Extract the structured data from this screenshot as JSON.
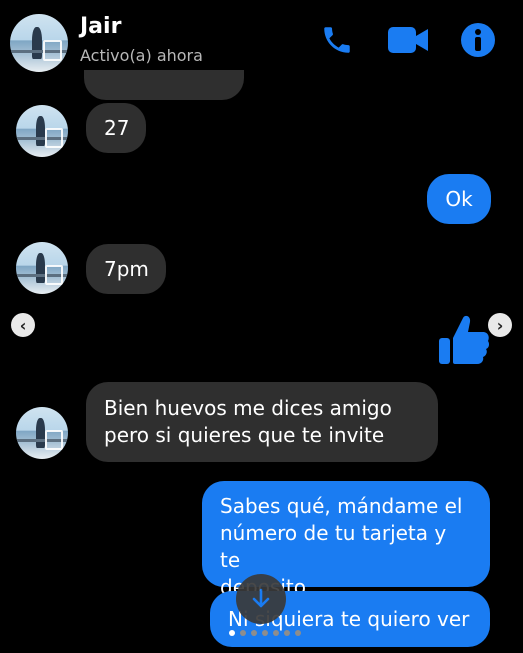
{
  "header": {
    "contact_name": "Jair",
    "status": "Activo(a) ahora",
    "icons": [
      "phone-icon",
      "video-camera-icon",
      "info-icon"
    ]
  },
  "messages": {
    "partial_top": "",
    "msg_27": "27",
    "msg_ok": "Ok",
    "msg_7pm": "7pm",
    "msg_bien_line1": "Bien huevos me dices amigo",
    "msg_bien_line2": "pero si quieres que te invite",
    "msg_sabes_line1": "Sabes qué, mándame el",
    "msg_sabes_line2": "número de tu tarjeta y te",
    "msg_sabes_line3": "deposito",
    "msg_ni_siquiera": "Ni siquiera te quiero ver"
  },
  "colors": {
    "background": "#000000",
    "incoming_bubble": "#2f2f2f",
    "outgoing_bubble": "#1a7cf2",
    "accent": "#1a7cf2"
  },
  "carousel": {
    "total_slides": 7,
    "active_slide": 1
  }
}
